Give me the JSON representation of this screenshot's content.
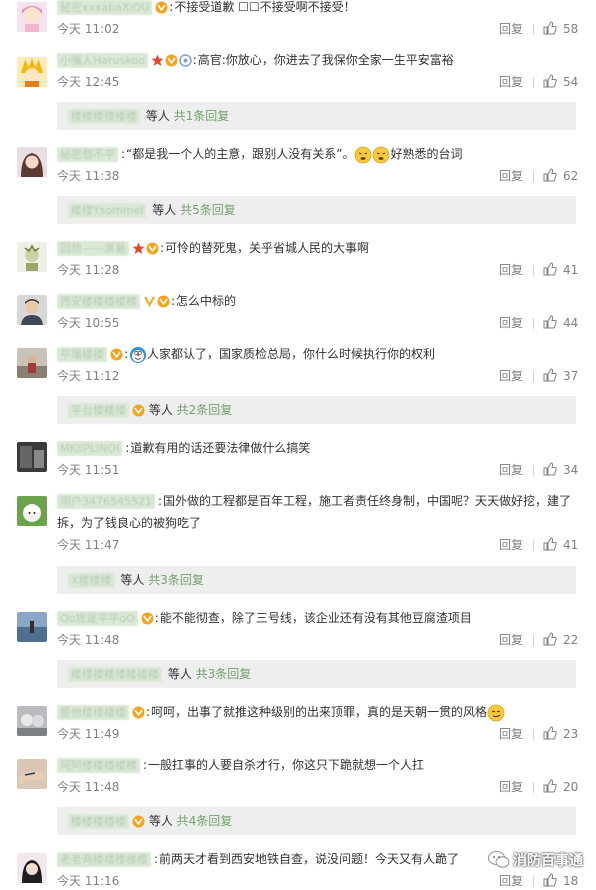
{
  "ui": {
    "reply_label": "回复",
    "more_prefix": "等人",
    "accent": "#73a36c"
  },
  "comments": [
    {
      "user": "秘密xxxabaXiOU",
      "text": "不接受道歉 ☐☐不接受啊不接受！",
      "time": "今天 11:02",
      "likes": "58",
      "avatar": "girl-avatar"
    },
    {
      "user": "小嘴人Haruskoo",
      "text": "高官:你放心，你进去了我保你全家一生平安富裕",
      "time": "今天 12:45",
      "likes": "54",
      "avatar": "cartoon-avatar"
    },
    {
      "user": "秘密想不平",
      "text": "“都是我一个人的主意，跟别人没有关系”。",
      "text2": "好熟悉的台词",
      "time": "今天 11:38",
      "likes": "62",
      "avatar": "woman-avatar"
    },
    {
      "user": "回想——黑暑",
      "text": "可怜的替死鬼，关乎省城人民的大事啊",
      "time": "今天 11:28",
      "likes": "41",
      "avatar": "cartoon2-avatar"
    },
    {
      "user": "西安楼楼楼楼楼",
      "text": "怎么中标的",
      "time": "今天 10:55",
      "likes": "44",
      "avatar": "man-avatar"
    },
    {
      "user": "平壤楼楼",
      "text": "人家都认了，国家质检总局，你什么时候执行你的权利",
      "time": "今天 11:12",
      "likes": "37",
      "avatar": "street-avatar"
    },
    {
      "user": "MKIIPLINOI",
      "text": "道歉有用的话还要法律做什么搞笑",
      "time": "今天 11:51",
      "likes": "34",
      "avatar": "dark-avatar"
    },
    {
      "user": "用户3476545521",
      "text": "国外做的工程都是百年工程，施工者责任终身制，中国呢？天天做好挖，建了",
      "text_line2": "拆，为了钱良心的被狗吃了",
      "time": "今天 11:47",
      "likes": "41",
      "avatar": "dog-avatar"
    },
    {
      "user": "Oo旅途平平oO",
      "text": "能不能彻查，除了三号线，该企业还有没有其他豆腐渣项目",
      "time": "今天 11:48",
      "likes": "22",
      "avatar": "sea-avatar"
    },
    {
      "user": "是他楼楼楼楼",
      "text": "呵呵，出事了就推这种级别的出来顶罪，真的是天朝一贯的风格",
      "time": "今天 11:49",
      "likes": "23",
      "avatar": "grey-avatar"
    },
    {
      "user": "阿阿楼楼楼楼楼",
      "text": "一般扛事的人要自杀才行，你这只下跪就想一个人扛",
      "time": "今天 11:48",
      "likes": "20",
      "avatar": "arm-avatar"
    },
    {
      "user": "老老两楼楼楼楼楼",
      "text": "前两天才看到西安地铁自查，说没问题！今天又有人跪了",
      "time": "今天 11:16",
      "likes": "18",
      "avatar": "girl2-avatar"
    }
  ],
  "subs": [
    {
      "names": "楼楼楼楼楼楼",
      "count": "共1条回复"
    },
    {
      "names": "楼楼Ysommel",
      "count": "共5条回复"
    },
    {
      "names": "平台楼楼楼",
      "count": "共2条回复"
    },
    {
      "names": "X楼楼楼",
      "count": "共3条回复"
    },
    {
      "names": "楼楼楼楼楼楼楼楼",
      "count": "共3条回复"
    },
    {
      "names": "楼楼楼楼楼",
      "count": "共4条回复"
    }
  ],
  "watermark": {
    "text": "消防百事通"
  }
}
